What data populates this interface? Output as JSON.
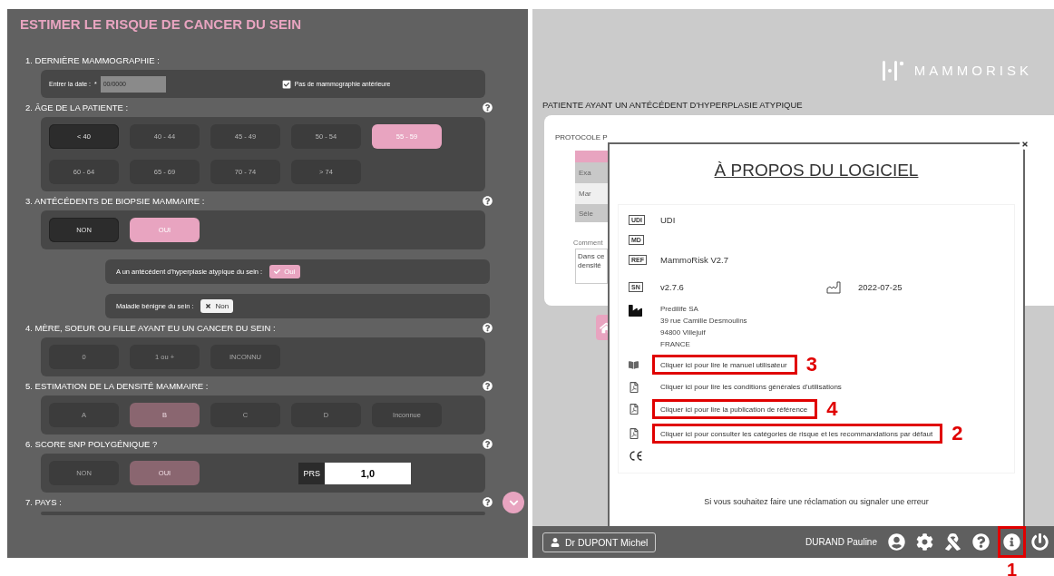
{
  "form": {
    "title": "ESTIMER LE RISQUE DE CANCER DU SEIN",
    "sections": [
      {
        "kind": "date",
        "label": "1. DERNIÈRE MAMMOGRAPHIE :",
        "help": false,
        "date_label": "Entrer la date :",
        "required_mark": "*",
        "date_placeholder": "00/0000",
        "no_previous": {
          "label": "Pas de mammographie antérieure",
          "checked": true
        }
      },
      {
        "kind": "choices",
        "label": "2. ÂGE DE LA PATIENTE :",
        "help": true,
        "disabled": false,
        "options": [
          {
            "label": "< 40",
            "selected": false,
            "pressed": true
          },
          {
            "label": "40 - 44",
            "selected": false,
            "pressed": false
          },
          {
            "label": "45 - 49",
            "selected": false,
            "pressed": false
          },
          {
            "label": "50 - 54",
            "selected": false,
            "pressed": false
          },
          {
            "label": "55 - 59",
            "selected": true,
            "pressed": false
          },
          {
            "label": "60 - 64",
            "selected": false,
            "pressed": false
          },
          {
            "label": "65 - 69",
            "selected": false,
            "pressed": false
          },
          {
            "label": "70 - 74",
            "selected": false,
            "pressed": false
          },
          {
            "label": "> 74",
            "selected": false,
            "pressed": false
          }
        ]
      },
      {
        "kind": "choices",
        "label": "3. ANTÉCÉDENTS DE BIOPSIE MAMMAIRE :",
        "help": true,
        "disabled": false,
        "options": [
          {
            "label": "NON",
            "selected": false,
            "pressed": true
          },
          {
            "label": "OUI",
            "selected": true,
            "pressed": false
          }
        ],
        "sub_questions": [
          {
            "label": "A un antécédent d'hyperplasie atypique du sein :",
            "answer": "Oui",
            "checked": true
          },
          {
            "label": "Maladie bénigne du sein :",
            "answer": "Non",
            "checked": false
          }
        ]
      },
      {
        "kind": "choices",
        "label": "4. MÈRE, SOEUR OU FILLE AYANT EU UN CANCER DU SEIN :",
        "help": true,
        "disabled": true,
        "options": [
          {
            "label": "0",
            "selected": false,
            "pressed": false
          },
          {
            "label": "1 ou +",
            "selected": false,
            "pressed": false
          },
          {
            "label": "INCONNU",
            "selected": false,
            "pressed": false
          }
        ]
      },
      {
        "kind": "choices",
        "label": "5. ESTIMATION DE LA DENSITÉ MAMMAIRE :",
        "help": true,
        "disabled": true,
        "options": [
          {
            "label": "A",
            "selected": false,
            "pressed": false
          },
          {
            "label": "B",
            "selected": true,
            "pressed": false
          },
          {
            "label": "C",
            "selected": false,
            "pressed": false
          },
          {
            "label": "D",
            "selected": false,
            "pressed": false
          },
          {
            "label": "Inconnue",
            "selected": false,
            "pressed": false
          }
        ]
      },
      {
        "kind": "choices",
        "label": "6. SCORE SNP POLYGÉNIQUE ?",
        "help": true,
        "disabled": true,
        "options": [
          {
            "label": "NON",
            "selected": false,
            "pressed": false
          },
          {
            "label": "OUI",
            "selected": true,
            "pressed": false
          }
        ],
        "prs": {
          "label": "PRS",
          "value": "1,0"
        }
      },
      {
        "kind": "cut",
        "label": "7. PAYS :",
        "help": true
      }
    ]
  },
  "brand": "MAMMORISK",
  "results": {
    "title": "PATIENTE AYANT UN ANTÉCÉDENT D'HYPERPLASIE ATYPIQUE",
    "protocol_label": "PROTOCOLE P",
    "rows": [
      "Exa",
      "Mar",
      "Séle"
    ],
    "comment_label": "Comment",
    "comment_lines": [
      "Dans ce",
      "densité"
    ]
  },
  "about": {
    "title": "À PROPOS DU LOGICIEL",
    "entries": [
      {
        "kind": "udi",
        "badge": "UDI",
        "text": "UDI"
      },
      {
        "kind": "md",
        "badge": "MD"
      },
      {
        "kind": "ref",
        "badge": "REF",
        "text": "MammoRisk V2.7"
      },
      {
        "kind": "sn",
        "badge": "SN",
        "text": "v2.7.6",
        "date": "2022-07-25"
      },
      {
        "kind": "manufacturer",
        "lines": [
          "Predilife SA",
          "39 rue Camille Desmoulins",
          "94800 Villejuif",
          "FRANCE"
        ]
      },
      {
        "kind": "manual",
        "text": "Cliquer ici pour lire le manuel utilisateur",
        "callout": "3"
      },
      {
        "kind": "pdf",
        "text": "Cliquer ici pour lire les conditions générales d'utilisations"
      },
      {
        "kind": "pdf",
        "text": "Cliquer ici pour lire la publication de référence",
        "callout": "4"
      },
      {
        "kind": "pdf",
        "text": "Cliquer ici pour consulter les catégories de risque et les recommandations par défaut",
        "callout": "2"
      },
      {
        "kind": "ce"
      }
    ],
    "footer": "Si vous souhaitez faire une réclamation ou signaler une erreur"
  },
  "status_bar": {
    "doctor": "Dr DUPONT Michel",
    "patient": "DURAND Pauline",
    "tools": [
      {
        "kind": "user"
      },
      {
        "kind": "settings"
      },
      {
        "kind": "ribbon"
      },
      {
        "kind": "help"
      },
      {
        "kind": "info",
        "callout": "1"
      },
      {
        "kind": "power"
      }
    ]
  }
}
